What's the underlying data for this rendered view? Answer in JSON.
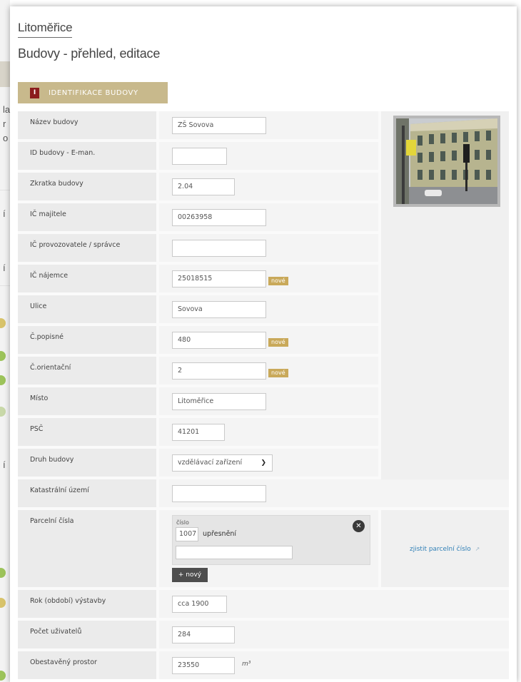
{
  "background": {
    "side_letters": [
      "la",
      "r",
      "o",
      "í",
      "í",
      "í"
    ]
  },
  "header": {
    "city": "Litoměřice",
    "title": "Budovy - přehled, editace"
  },
  "section": {
    "number": "I",
    "label": "IDENTIFIKACE BUDOVY"
  },
  "fields": {
    "nazev": {
      "label": "Název budovy",
      "value": "ZŠ Sovova"
    },
    "id_eman": {
      "label": "ID budovy - E-man.",
      "value": ""
    },
    "zkratka": {
      "label": "Zkratka budovy",
      "value": "2.04"
    },
    "ic_majitele": {
      "label": "IČ majitele",
      "value": "00263958"
    },
    "ic_provozovatele": {
      "label": "IČ provozovatele / správce",
      "value": ""
    },
    "ic_najemce": {
      "label": "IČ nájemce",
      "value": "25018515",
      "badge": "nové"
    },
    "ulice": {
      "label": "Ulice",
      "value": "Sovova"
    },
    "cislo_popisne": {
      "label": "Č.popisné",
      "value": "480",
      "badge": "nové"
    },
    "cislo_orientacni": {
      "label": "Č.orientační",
      "value": "2",
      "badge": "nové"
    },
    "misto": {
      "label": "Místo",
      "value": "Litoměřice"
    },
    "psc": {
      "label": "PSČ",
      "value": "41201"
    },
    "druh": {
      "label": "Druh budovy",
      "value": "vzdělávací zařízení"
    },
    "katastralni": {
      "label": "Katastrální území",
      "value": ""
    },
    "parcelni": {
      "label": "Parcelní čísla",
      "sub_label": "číslo",
      "number": "1007",
      "upresneni_label": "upřesnění",
      "upresneni_value": "",
      "add_button": "+ nový",
      "link": "zjistit parcelní číslo"
    },
    "rok": {
      "label": "Rok (období) výstavby",
      "value": "cca 1900"
    },
    "pocet": {
      "label": "Počet uživatelů",
      "value": "284"
    },
    "prostor": {
      "label": "Obestavěný prostor",
      "value": "23550",
      "unit": "m³"
    }
  },
  "colors": {
    "section_bg": "#c8b98c",
    "section_num_bg": "#8b1d1d",
    "badge": "#c9a95a",
    "link": "#2f7fb6"
  }
}
